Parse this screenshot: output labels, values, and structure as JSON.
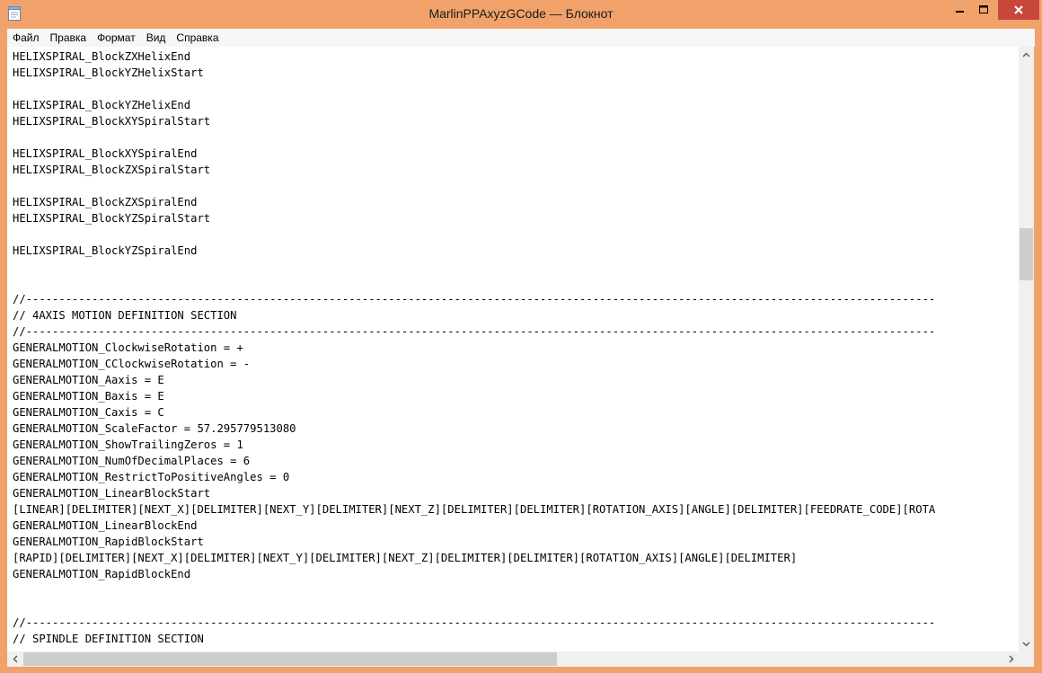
{
  "window": {
    "title": "MarlinPPAxyzGCode — Блокнот"
  },
  "menu": {
    "items": [
      "Файл",
      "Правка",
      "Формат",
      "Вид",
      "Справка"
    ]
  },
  "editor": {
    "lines": [
      "HELIXSPIRAL_BlockZXHelixEnd",
      "HELIXSPIRAL_BlockYZHelixStart",
      "",
      "HELIXSPIRAL_BlockYZHelixEnd",
      "HELIXSPIRAL_BlockXYSpiralStart",
      "",
      "HELIXSPIRAL_BlockXYSpiralEnd",
      "HELIXSPIRAL_BlockZXSpiralStart",
      "",
      "HELIXSPIRAL_BlockZXSpiralEnd",
      "HELIXSPIRAL_BlockYZSpiralStart",
      "",
      "HELIXSPIRAL_BlockYZSpiralEnd",
      "",
      "",
      "//------------------------------------------------------------------------------------------------------------------------------------------",
      "// 4AXIS MOTION DEFINITION SECTION",
      "//------------------------------------------------------------------------------------------------------------------------------------------",
      "GENERALMOTION_ClockwiseRotation = +",
      "GENERALMOTION_CClockwiseRotation = -",
      "GENERALMOTION_Aaxis = E",
      "GENERALMOTION_Baxis = E",
      "GENERALMOTION_Caxis = C",
      "GENERALMOTION_ScaleFactor = 57.295779513080",
      "GENERALMOTION_ShowTrailingZeros = 1",
      "GENERALMOTION_NumOfDecimalPlaces = 6",
      "GENERALMOTION_RestrictToPositiveAngles = 0",
      "GENERALMOTION_LinearBlockStart",
      "[LINEAR][DELIMITER][NEXT_X][DELIMITER][NEXT_Y][DELIMITER][NEXT_Z][DELIMITER][DELIMITER][ROTATION_AXIS][ANGLE][DELIMITER][FEEDRATE_CODE][ROTA",
      "GENERALMOTION_LinearBlockEnd",
      "GENERALMOTION_RapidBlockStart",
      "[RAPID][DELIMITER][NEXT_X][DELIMITER][NEXT_Y][DELIMITER][NEXT_Z][DELIMITER][DELIMITER][ROTATION_AXIS][ANGLE][DELIMITER]",
      "GENERALMOTION_RapidBlockEnd",
      "",
      "",
      "//------------------------------------------------------------------------------------------------------------------------------------------",
      "// SPINDLE DEFINITION SECTION"
    ]
  },
  "icons": {
    "app": "notepad-icon",
    "minimize": "minimize-icon",
    "maximize": "maximize-icon",
    "close": "close-icon"
  },
  "colors": {
    "frame": "#f0a26a",
    "close": "#c7473d"
  }
}
